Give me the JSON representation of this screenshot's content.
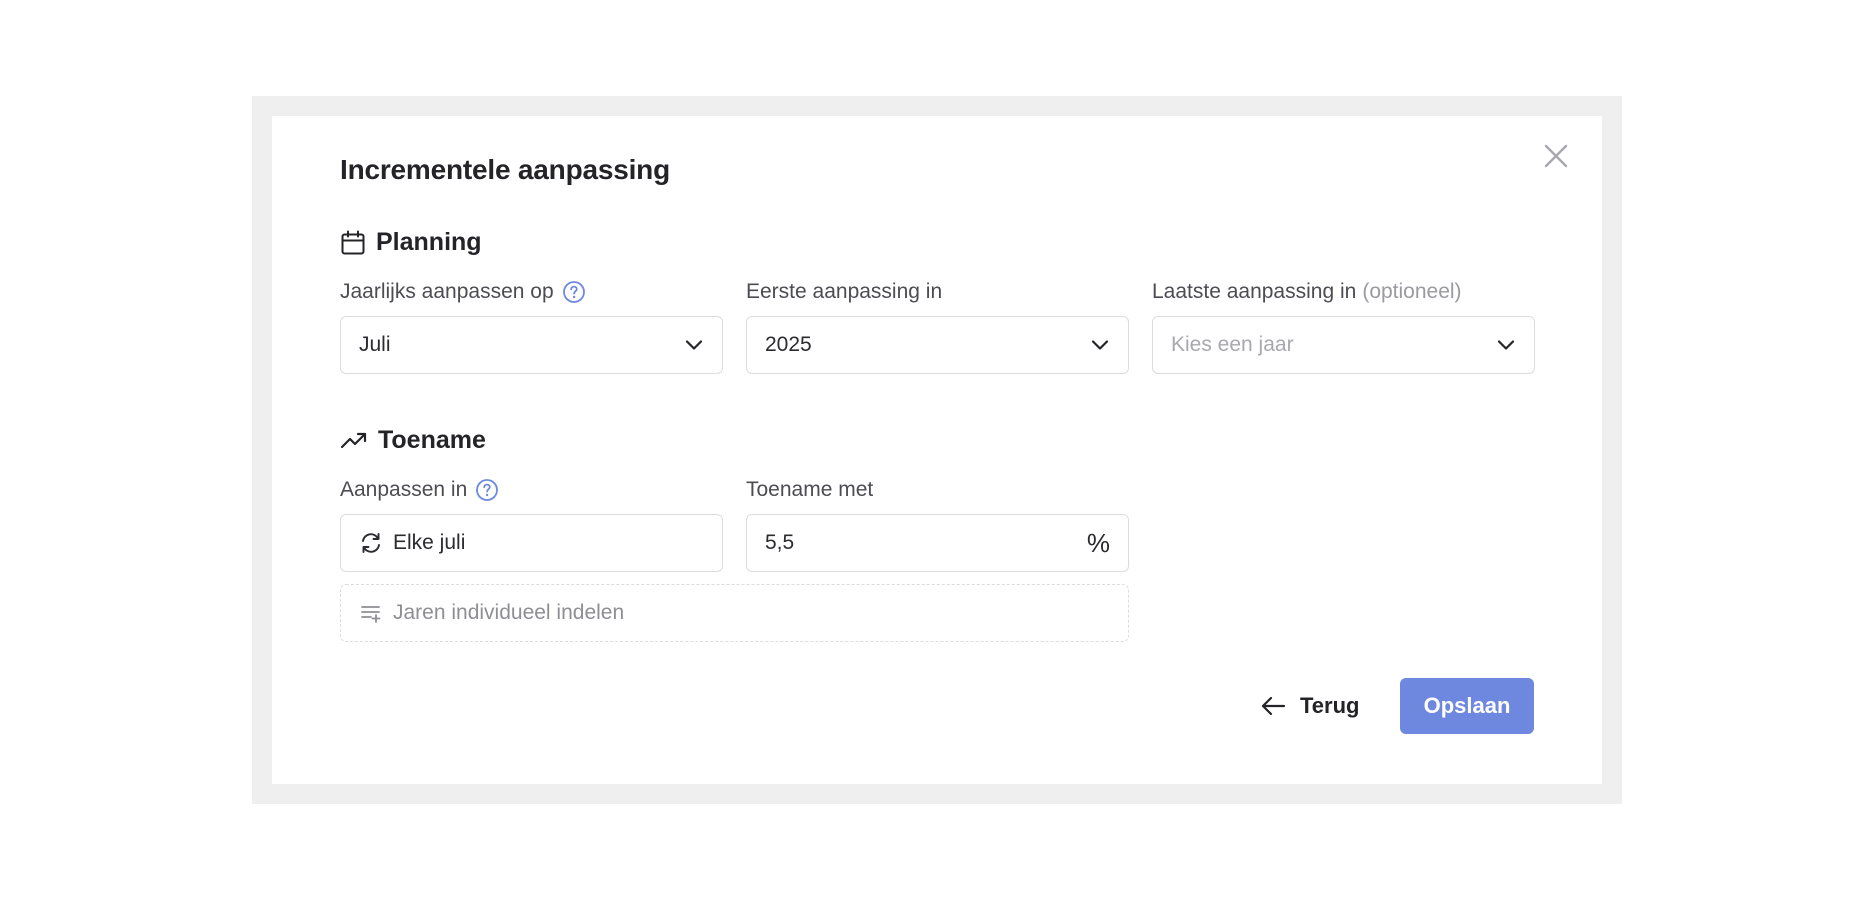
{
  "dialog": {
    "title": "Incrementele aanpassing",
    "close_icon": "close-icon"
  },
  "planning": {
    "heading": "Planning",
    "icon": "calendar-icon",
    "annual": {
      "label": "Jaarlijks aanpassen op",
      "value": "Juli"
    },
    "first": {
      "label": "Eerste aanpassing in",
      "value": "2025"
    },
    "last": {
      "label": "Laatste aanpassing in",
      "optional": "(optioneel)",
      "placeholder": "Kies een jaar"
    }
  },
  "increase": {
    "heading": "Toename",
    "icon": "trending-up-icon",
    "adjust_in": {
      "label": "Aanpassen in",
      "value": "Elke juli"
    },
    "increase_by": {
      "label": "Toename met",
      "value": "5,5",
      "unit": "%"
    },
    "individual_years": "Jaren individueel indelen"
  },
  "actions": {
    "back": "Terug",
    "save": "Opslaan"
  },
  "colors": {
    "accent": "#6f88df",
    "help": "#6f88df",
    "border": "#dcdce0"
  }
}
